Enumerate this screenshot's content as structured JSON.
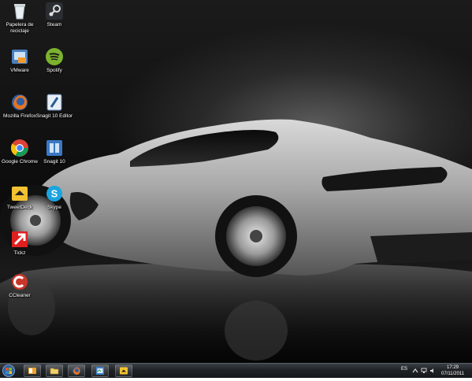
{
  "desktop": {
    "icons": [
      {
        "label": "Papelera de reciclaje",
        "icon": "recycle-bin-icon"
      },
      {
        "label": "Steam",
        "icon": "steam-icon"
      },
      {
        "label": "VMware",
        "icon": "vmware-icon"
      },
      {
        "label": "Spotify",
        "icon": "spotify-icon"
      },
      {
        "label": "Mozilla Firefox",
        "icon": "firefox-icon"
      },
      {
        "label": "Snagit 10 Editor",
        "icon": "snagit-editor-icon"
      },
      {
        "label": "Google Chrome",
        "icon": "chrome-icon"
      },
      {
        "label": "Snagit 10",
        "icon": "snagit-icon"
      },
      {
        "label": "TweetDeck",
        "icon": "tweetdeck-icon"
      },
      {
        "label": "Skype",
        "icon": "skype-icon"
      },
      {
        "label": "Tickz",
        "icon": "tickz-icon"
      },
      {
        "label": "CCleaner",
        "icon": "ccleaner-icon"
      }
    ],
    "wallpaper": "silver sports car on black background"
  },
  "taskbar": {
    "pinned": [
      "outlook-icon",
      "explorer-folder-icon",
      "firefox-icon",
      "shell-icon",
      "tweetdeck-icon"
    ],
    "tray": {
      "language": "ES",
      "time": "17:29",
      "date": "07/11/2011"
    }
  },
  "colors": {
    "taskbar": "#1f2327",
    "label_text": "#ffffff"
  }
}
